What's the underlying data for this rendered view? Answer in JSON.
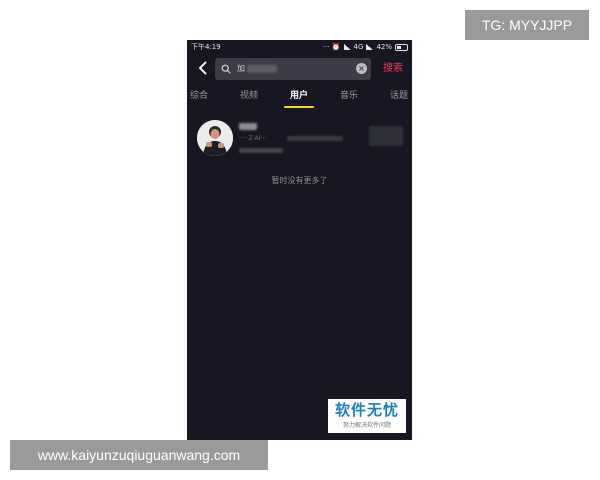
{
  "status_bar": {
    "time": "下午4:19",
    "indicators": "··· ⏰",
    "network": "4G",
    "battery": "42%"
  },
  "search": {
    "back_icon": "chevron-left-icon",
    "search_icon": "magnifier-icon",
    "query_visible": "加",
    "clear_icon": "clear-x-icon",
    "clear_glyph": "×",
    "submit_label": "搜索"
  },
  "tabs": [
    {
      "label": "综合"
    },
    {
      "label": "视频"
    },
    {
      "label": "用户",
      "active": true
    },
    {
      "label": "音乐"
    },
    {
      "label": "话题"
    }
  ],
  "result": {
    "stats_visible": "··· ·Z·AI···"
  },
  "empty_message": "暂时没有更多了",
  "watermarks": {
    "top_right": "TG: MYYJJPP",
    "bottom_left": "www.kaiyunzuqiuguanwang.com",
    "brand_title": "软件无忧",
    "brand_subtitle": "努力解决软件问题"
  },
  "colors": {
    "accent": "#f2385a",
    "tab_indicator": "#f9d42a",
    "background": "#161722"
  }
}
